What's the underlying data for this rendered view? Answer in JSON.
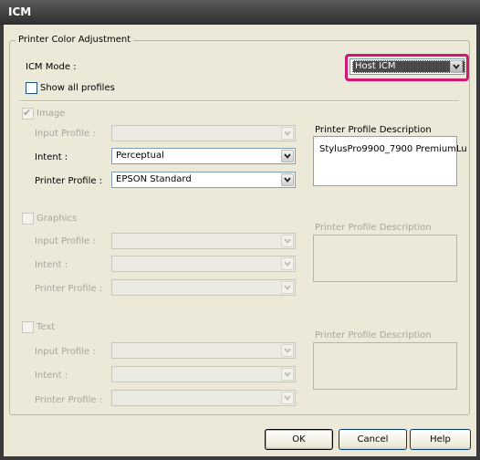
{
  "window": {
    "title": "ICM"
  },
  "group": {
    "legend": "Printer Color Adjustment"
  },
  "icm_mode": {
    "label": "ICM Mode :",
    "value": "Host ICM"
  },
  "show_all_profiles": {
    "label": "Show all profiles",
    "checked": false
  },
  "image": {
    "label": "Image",
    "checked": true,
    "enabled": true,
    "input_profile": {
      "label": "Input Profile :",
      "value": ""
    },
    "intent": {
      "label": "Intent :",
      "value": "Perceptual"
    },
    "printer_profile": {
      "label": "Printer Profile :",
      "value": "EPSON Standard"
    },
    "description_label": "Printer Profile Description",
    "description": "StylusPro9900_7900 PremiumLu"
  },
  "graphics": {
    "label": "Graphics",
    "checked": false,
    "enabled": false,
    "input_profile": {
      "label": "Input Profile :",
      "value": ""
    },
    "intent": {
      "label": "Intent :",
      "value": ""
    },
    "printer_profile": {
      "label": "Printer Profile :",
      "value": ""
    },
    "description_label": "Printer Profile Description"
  },
  "text": {
    "label": "Text",
    "checked": false,
    "enabled": false,
    "input_profile": {
      "label": "Input Profile :",
      "value": ""
    },
    "intent": {
      "label": "Intent :",
      "value": ""
    },
    "printer_profile": {
      "label": "Printer Profile :",
      "value": ""
    },
    "description_label": "Printer Profile Description"
  },
  "buttons": {
    "ok": "OK",
    "cancel": "Cancel",
    "help": "Help"
  },
  "icons": {
    "dropdown": "chevron-down-icon",
    "check": "check-icon"
  },
  "colors": {
    "highlight": "#d11773",
    "dialog_bg": "#ece9d8",
    "titlebar": "#3a3a3a"
  }
}
